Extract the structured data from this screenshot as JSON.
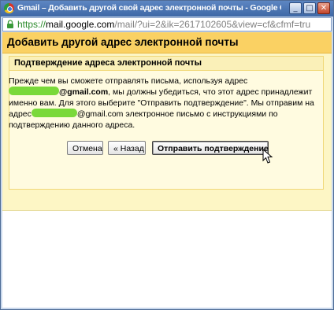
{
  "window": {
    "title": "Gmail – Добавить другой свой адрес электронной почты - Google Chro...",
    "minimize_glyph": "_",
    "maximize_glyph": "□",
    "close_glyph": "✕"
  },
  "address_bar": {
    "protocol": "https://",
    "host": "mail.google.com",
    "path": "/mail/?ui=2&ik=2617102605&view=cf&cfmf=tru"
  },
  "dialog": {
    "title": "Добавить другой адрес электронной почты",
    "section_title": "Подтверждение адреса электронной почты",
    "text": {
      "line1": "Прежде чем вы сможете отправлять письма, используя адрес",
      "email_domain": "@gmail.com",
      "line2_rest": ", мы должны убедиться, что этот адрес принадлежит именно вам. Для этого выберите \"Отправить подтверждение\". Мы отправим на",
      "line3_start": "адрес",
      "email_domain_plain": "@gmail.com",
      "line3_rest": " электронное письмо с инструкциями по подтверждению данного адреса."
    },
    "buttons": {
      "cancel": "Отмена",
      "back": "« Назад",
      "send": "Отправить подтверждение"
    }
  },
  "colors": {
    "header_bg": "#fad163",
    "dialog_bg": "#fdf6c5",
    "redaction": "#7ad93a",
    "titlebar": "#3e68a6"
  }
}
